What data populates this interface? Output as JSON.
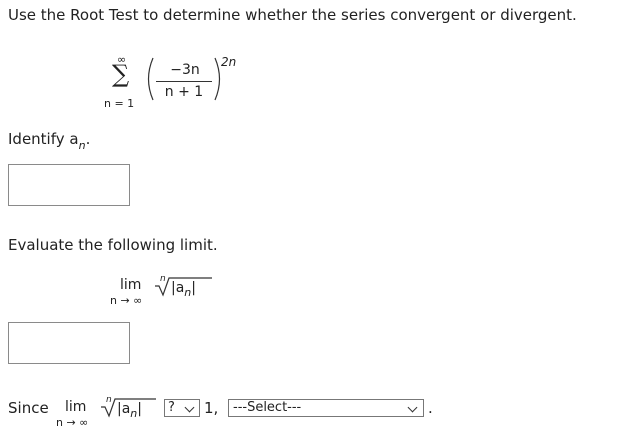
{
  "question": "Use the Root Test to determine whether the series convergent or divergent.",
  "series": {
    "sigma": "∑",
    "upper": "∞",
    "lower": "n = 1",
    "numerator": "−3n",
    "denominator": "n + 1",
    "exponent": "2n"
  },
  "identify": {
    "label": "Identify a",
    "subscript": "n",
    "trailing": ".",
    "answer_value": ""
  },
  "evaluate": {
    "label": "Evaluate the following limit.",
    "lim": "lim",
    "lim_sub": "n → ∞",
    "root_index": "n",
    "radicand": "|a",
    "radicand_sub": "n",
    "radicand_close": "|",
    "answer_value": ""
  },
  "since": {
    "label": "Since",
    "lim": "lim",
    "lim_sub": "n → ∞",
    "root_index": "n",
    "radicand": "|a",
    "radicand_sub": "n",
    "radicand_close": "|",
    "comparison_select": "?",
    "value": "1,",
    "conclusion_select": "---Select---",
    "period": "."
  }
}
